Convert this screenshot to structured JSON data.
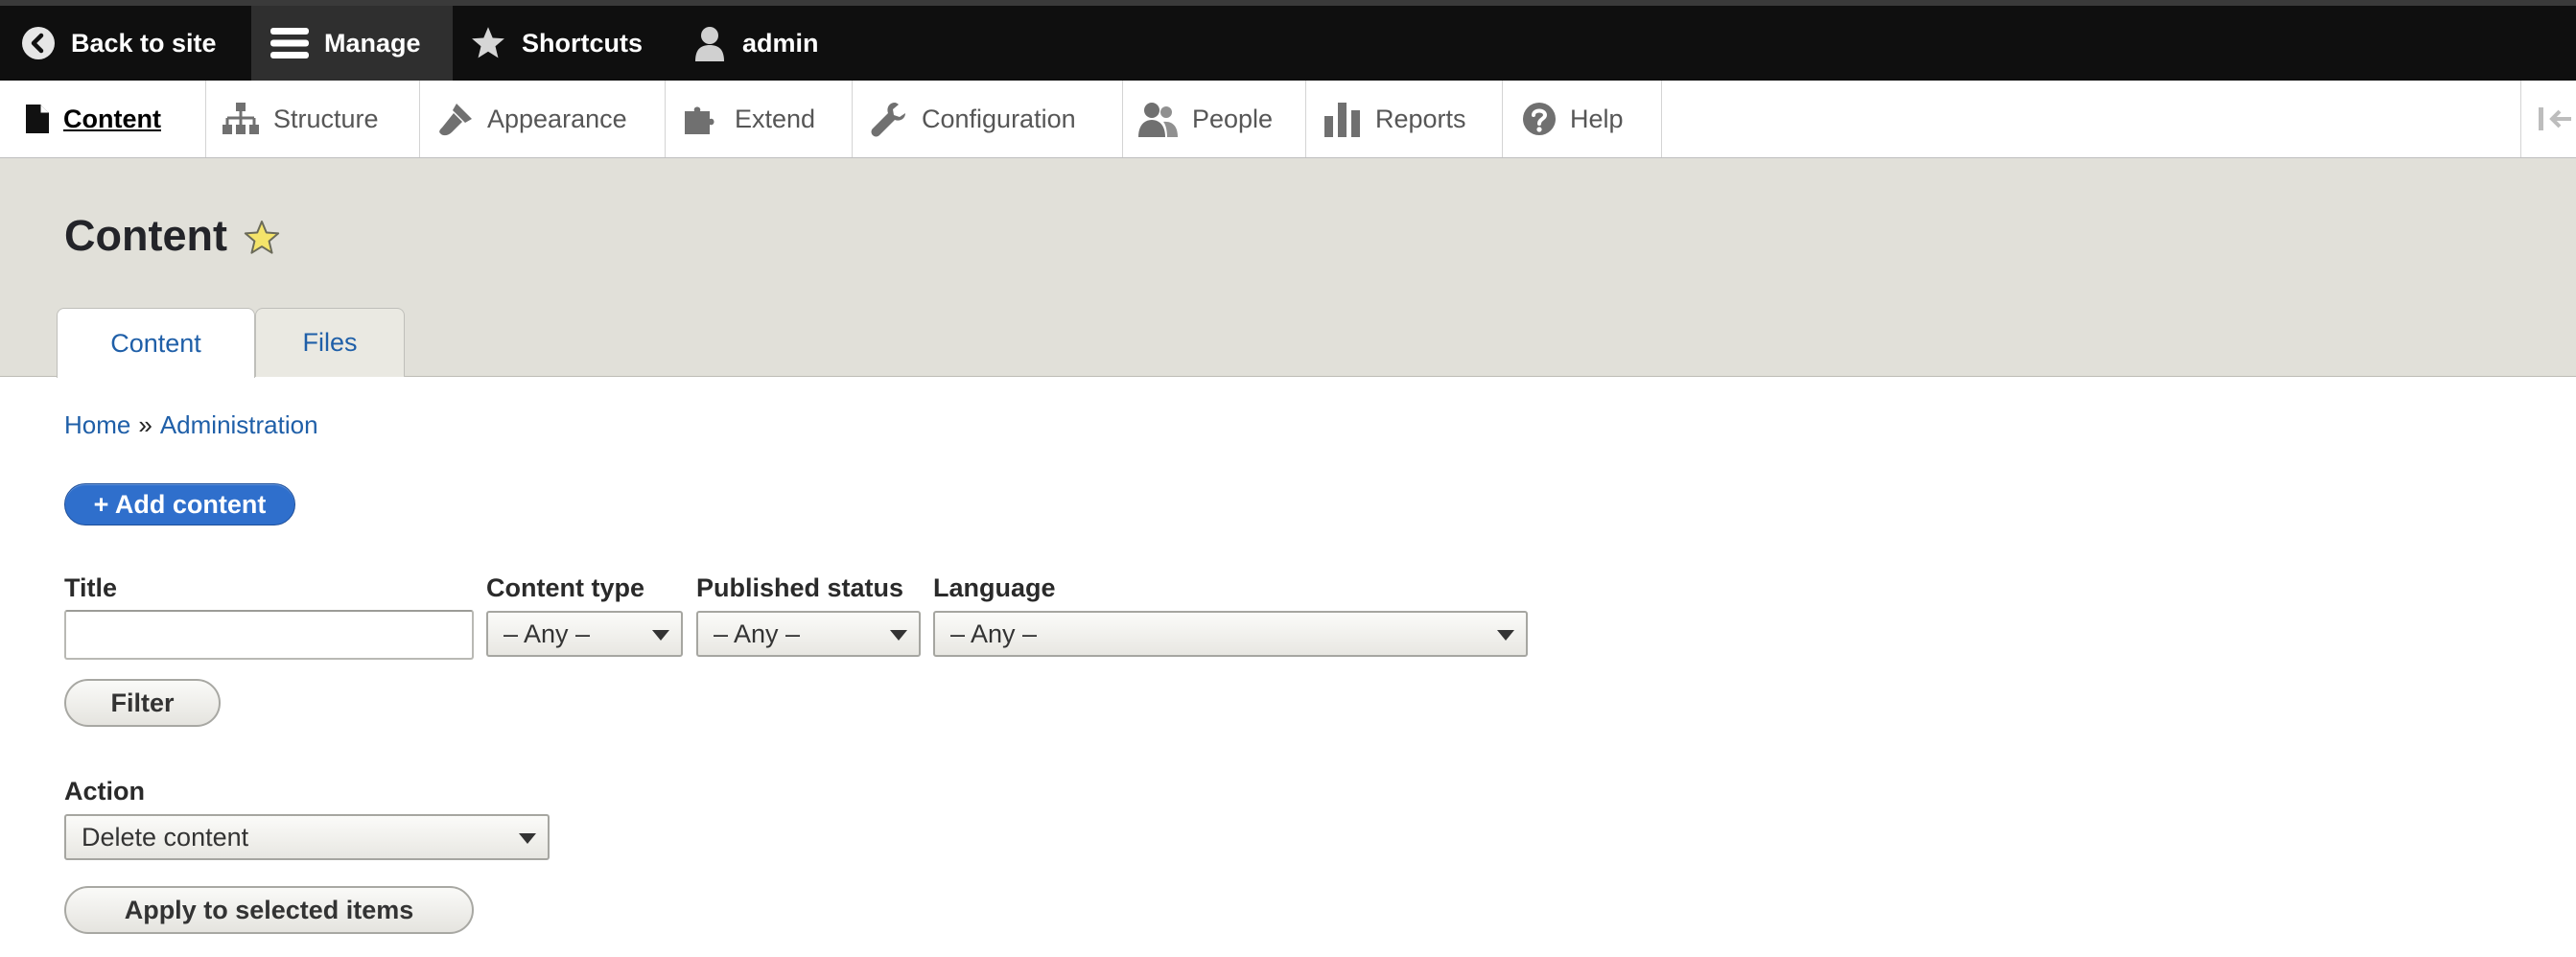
{
  "toolbar": {
    "back_label": "Back to site",
    "manage_label": "Manage",
    "shortcuts_label": "Shortcuts",
    "user_label": "admin"
  },
  "tray": {
    "items": [
      {
        "label": "Content",
        "icon": "file-icon",
        "active": true
      },
      {
        "label": "Structure",
        "icon": "sitemap-icon"
      },
      {
        "label": "Appearance",
        "icon": "paint-brush-icon"
      },
      {
        "label": "Extend",
        "icon": "puzzle-icon"
      },
      {
        "label": "Configuration",
        "icon": "wrench-icon"
      },
      {
        "label": "People",
        "icon": "people-icon"
      },
      {
        "label": "Reports",
        "icon": "bar-chart-icon"
      },
      {
        "label": "Help",
        "icon": "help-icon"
      }
    ]
  },
  "page": {
    "title": "Content",
    "tabs": [
      {
        "label": "Content",
        "active": true
      },
      {
        "label": "Files"
      }
    ],
    "breadcrumb": {
      "home": "Home",
      "separator": "»",
      "current": "Administration"
    },
    "add_button": "+ Add content"
  },
  "filters": {
    "title_label": "Title",
    "title_value": "",
    "content_type_label": "Content type",
    "content_type_value": "– Any –",
    "status_label": "Published status",
    "status_value": "– Any –",
    "language_label": "Language",
    "language_value": "– Any –",
    "filter_button": "Filter"
  },
  "bulk": {
    "action_label": "Action",
    "action_value": "Delete content",
    "apply_button": "Apply to selected items"
  },
  "colors": {
    "toolbar_bg": "#0f0f0f",
    "header_bg": "#e1e0d9",
    "link": "#1f5fa8",
    "primary_button": "#2f6fcc",
    "star": "#f4e46a"
  }
}
